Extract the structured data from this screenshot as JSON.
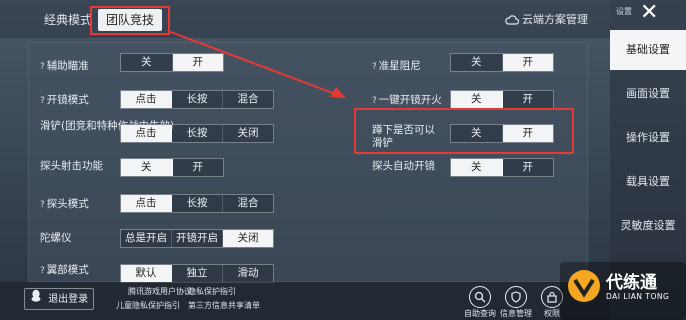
{
  "tabs": [
    {
      "label": "经典模式"
    },
    {
      "label": "团队竞技"
    }
  ],
  "cloud_label": "云端方案管理",
  "left_settings": [
    {
      "label": "辅助瞄准",
      "help": "?",
      "options": [
        "关",
        "开"
      ],
      "selected": 1
    },
    {
      "label": "开镜模式",
      "help": "?",
      "options": [
        "点击",
        "长按",
        "混合"
      ],
      "selected": 0
    },
    {
      "label": "滑铲(团竞和特种作战中生效)",
      "help": "",
      "options": [
        "点击",
        "长按",
        "关闭"
      ],
      "selected": 0
    },
    {
      "label": "探头射击功能",
      "help": "",
      "options": [
        "关",
        "开"
      ],
      "selected": 0
    },
    {
      "label": "探头模式",
      "help": "?",
      "options": [
        "点击",
        "长按",
        "混合"
      ],
      "selected": 0
    },
    {
      "label": "陀螺仪",
      "help": "",
      "options": [
        "总是开启",
        "开镜开启",
        "关闭"
      ],
      "selected": 2
    },
    {
      "label": "翼部模式",
      "help": "?",
      "options": [
        "默认",
        "独立",
        "滑动"
      ],
      "selected": 0
    }
  ],
  "right_settings": [
    {
      "label": "准星阻尼",
      "help": "?",
      "options": [
        "关",
        "开"
      ],
      "selected": 1
    },
    {
      "label": "一键开镜开火",
      "help": "?",
      "options": [
        "关",
        "开"
      ],
      "selected": 0
    },
    {
      "label": "蹲下是否可以滑铲",
      "help": "",
      "options": [
        "关",
        "开"
      ],
      "selected": 1
    },
    {
      "label": "探头自动开镜",
      "help": "",
      "options": [
        "关",
        "开"
      ],
      "selected": 0
    }
  ],
  "sidebar": {
    "tag": "设置",
    "close": "✕",
    "items": [
      {
        "label": "基础设置"
      },
      {
        "label": "画面设置"
      },
      {
        "label": "操作设置"
      },
      {
        "label": "载具设置"
      },
      {
        "label": "灵敏度设置"
      }
    ],
    "active": 0
  },
  "bottom": {
    "logout": "退出登录",
    "links": [
      "腾讯游戏用户协议",
      "隐私保护指引",
      "儿童隐私保护指引",
      "第三方信息共享清单"
    ],
    "icons": [
      {
        "label": "自助查询"
      },
      {
        "label": "信息管理"
      },
      {
        "label": "权限"
      }
    ]
  },
  "watermark": {
    "cn": "代练通",
    "en": "DAI LIAN TONG"
  },
  "colors": {
    "highlight": "#e53935",
    "selected_bg": "#f2f4f6"
  }
}
